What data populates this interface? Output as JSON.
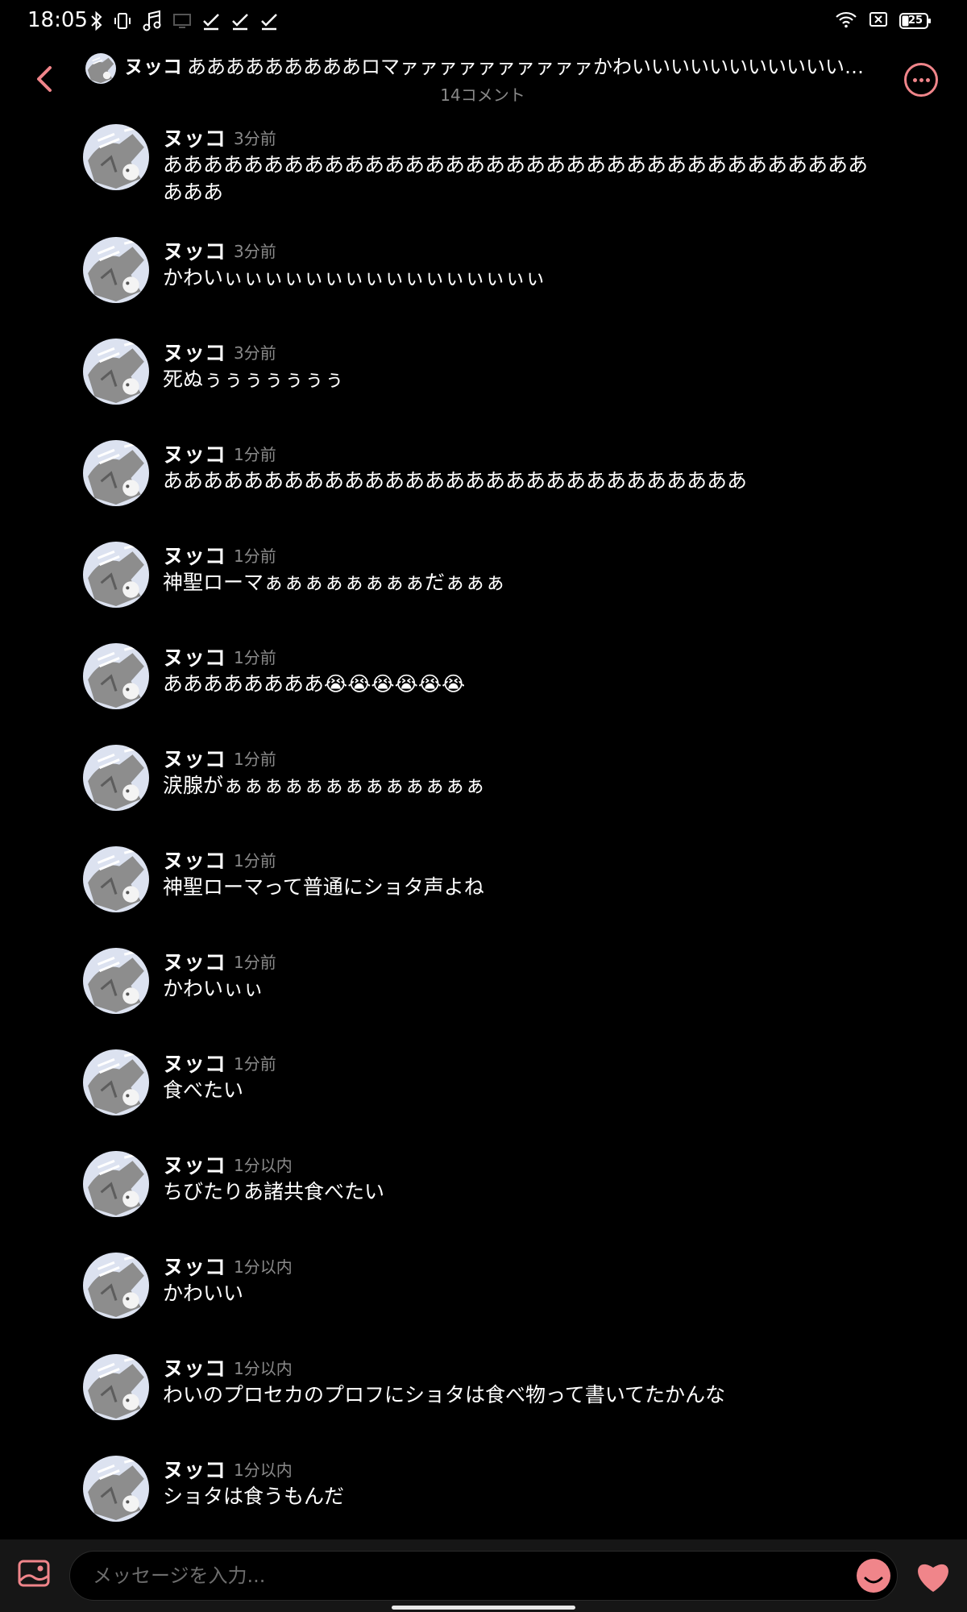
{
  "status_bar": {
    "time": "18:05",
    "left_icons": [
      "bluetooth-icon",
      "vibrate-icon",
      "music-note-icon",
      "screen-icon",
      "check-icon",
      "check-icon",
      "check-icon"
    ],
    "right_icons": [
      "wifi-icon",
      "sim-off-icon",
      "battery-icon"
    ],
    "battery": "25"
  },
  "header": {
    "author": "ヌッコ",
    "title_text": "あああああああああロマァァァァァァァァァァかわいいいいいいいいいいいいい…",
    "comment_count": "14コメント",
    "accent_color": "#f0858a"
  },
  "comments": [
    {
      "name": "ヌッコ",
      "time": "3分前",
      "text": "ああああああああああああああああああああああああああああああああああああああ"
    },
    {
      "name": "ヌッコ",
      "time": "3分前",
      "text": "かわいぃぃぃぃぃぃぃぃぃぃぃぃぃぃぃぃ"
    },
    {
      "name": "ヌッコ",
      "time": "3分前",
      "text": "死ぬぅぅぅぅぅぅぅ"
    },
    {
      "name": "ヌッコ",
      "time": "1分前",
      "text": "あああああああああああああああああああああああああああああ"
    },
    {
      "name": "ヌッコ",
      "time": "1分前",
      "text": "神聖ローマぁぁぁぁぁぁぁぁだぁぁぁ"
    },
    {
      "name": "ヌッコ",
      "time": "1分前",
      "text": "ああああああああ😭😭😭😭😭😭"
    },
    {
      "name": "ヌッコ",
      "time": "1分前",
      "text": "涙腺がぁぁぁぁぁぁぁぁぁぁぁぁぁ"
    },
    {
      "name": "ヌッコ",
      "time": "1分前",
      "text": "神聖ローマって普通にショタ声よね"
    },
    {
      "name": "ヌッコ",
      "time": "1分前",
      "text": "かわいぃぃ"
    },
    {
      "name": "ヌッコ",
      "time": "1分前",
      "text": "食べたい"
    },
    {
      "name": "ヌッコ",
      "time": "1分以内",
      "text": "ちびたりあ諸共食べたい"
    },
    {
      "name": "ヌッコ",
      "time": "1分以内",
      "text": "かわいい"
    },
    {
      "name": "ヌッコ",
      "time": "1分以内",
      "text": "わいのプロセカのプロフにショタは食べ物って書いてたかんな"
    },
    {
      "name": "ヌッコ",
      "time": "1分以内",
      "text": "ショタは食うもんだ"
    }
  ],
  "input": {
    "placeholder": "メッセージを入力..."
  },
  "bottom_icons": [
    "image-icon",
    "emoji-icon",
    "heart-icon"
  ]
}
